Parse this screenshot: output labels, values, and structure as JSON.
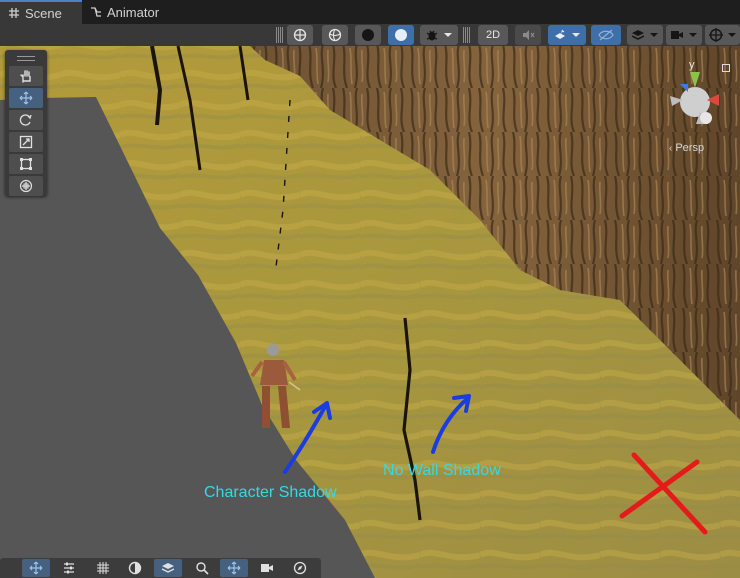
{
  "tabs": [
    {
      "label": "Scene",
      "icon": "grid-icon",
      "active": true
    },
    {
      "label": "Animator",
      "icon": "animator-icon",
      "active": false
    }
  ],
  "toolbar": {
    "toggle_2d_label": "2D",
    "buttons": [
      "orientation-gizmo-icon",
      "shading-wireframe-icon",
      "shading-solid-icon",
      "shading-lit-icon",
      "bug-icon",
      "2d-toggle",
      "audio-mute-icon",
      "fx-icon",
      "visibility-icon",
      "layers-icon",
      "camera-icon",
      "gizmos-icon"
    ]
  },
  "scene_tools": [
    "hand-tool-icon",
    "move-tool-icon",
    "rotate-tool-icon",
    "scale-tool-icon",
    "rect-tool-icon",
    "transform-tool-icon"
  ],
  "gizmo": {
    "y_label": "y",
    "projection_label": "Persp",
    "axis_colors": {
      "x": "#e0473c",
      "y": "#8ac34a",
      "z": "#3d7be2"
    }
  },
  "annotations": {
    "character_shadow": "Character Shadow",
    "no_wall_shadow": "No Wall Shadow",
    "text_color": "#36d8e6",
    "arrow_color": "#1a3de0",
    "cross_color": "#e51a1a"
  },
  "overlay_bar": [
    "move-tool-icon",
    "sliders-icon",
    "grid-snap-icon",
    "circle-icon",
    "layers-stack-icon",
    "search-icon",
    "move-tool-icon",
    "camera-icon",
    "compass-icon"
  ]
}
